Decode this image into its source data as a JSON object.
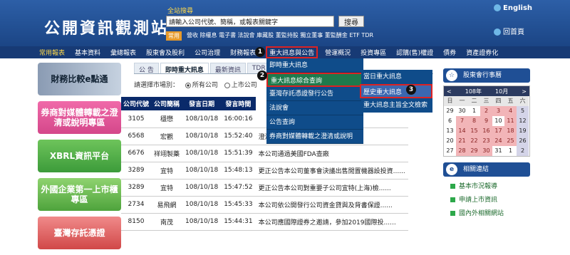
{
  "header": {
    "logo": "公開資訊觀測站",
    "search_title": "全站搜尋",
    "search_placeholder": "請輸入公司代號、簡稱，或報表關鍵字",
    "search_button": "搜尋",
    "common_badge": "常用",
    "common_links": "營收 除權息 電子書 法說會 庫藏股 董監持股 獨立董事 董監酬金 ETF TDR",
    "english": "English",
    "home": "回首頁"
  },
  "nav": {
    "items": [
      "常用報表",
      "基本資料",
      "彙總報表",
      "股東會及股利",
      "公司治理",
      "財務報表",
      "重大訊息與公告",
      "營運概況",
      "投資專區",
      "認購(售)權證",
      "債券",
      "資產證券化"
    ]
  },
  "left_banners": [
    "財務比較e點通",
    "券商對媒體轉載之澄清或說明專區",
    "XBRL資訊平台",
    "外國企業第一上市櫃專區",
    "臺灣存託憑證"
  ],
  "sub_tabs": [
    "公  告",
    "即時重大訊息",
    "最新資訊",
    "TDR"
  ],
  "market": {
    "label": "請選擇市場別：",
    "options": [
      "所有公司",
      "上市公司"
    ]
  },
  "menu1": [
    "即時重大訊息",
    "重大訊息綜合查詢",
    "臺灣存託憑證發行公告",
    "法說會",
    "公告查詢",
    "券商對媒體轉載之澄清或說明"
  ],
  "menu2": [
    "當日重大訊息",
    "歷史重大訊息",
    "重大訊息主旨全文檢索"
  ],
  "badges": [
    "1",
    "2",
    "3"
  ],
  "table": {
    "headers": [
      "公司代號",
      "公司簡稱",
      "發言日期",
      "發言時間"
    ],
    "rows": [
      [
        "3105",
        "穩懋",
        "108/10/18",
        "16:00:16",
        ""
      ],
      [
        "6568",
        "宏觀",
        "108/10/18",
        "15:52:40",
        "澄清媒體報導"
      ],
      [
        "6676",
        "祥翊製藥",
        "108/10/18",
        "15:51:39",
        "本公司通過美國FDA查廠"
      ],
      [
        "3289",
        "宜特",
        "108/10/18",
        "15:48:13",
        "更正公告本公司董事會決議出售閒置機器設投資......"
      ],
      [
        "3289",
        "宜特",
        "108/10/18",
        "15:47:52",
        "更正公告本公司對重要子公司宜特(上海)檢......"
      ],
      [
        "2734",
        "易飛網",
        "108/10/18",
        "15:45:33",
        "本公司依公開發行公司資金貸與及背書保證......"
      ],
      [
        "8150",
        "南茂",
        "108/10/18",
        "15:44:31",
        "本公司應國際證券之邀請，參加2019國際投......"
      ]
    ]
  },
  "right": {
    "calendar_title": "股東會行事曆",
    "year": "108年",
    "month": "10月",
    "weekdays": [
      "日",
      "一",
      "二",
      "三",
      "四",
      "五",
      "六"
    ],
    "weeks": [
      [
        "29",
        "30",
        "1",
        "2",
        "3",
        "4",
        "5"
      ],
      [
        "6",
        "7",
        "8",
        "9",
        "10",
        "11",
        "12"
      ],
      [
        "13",
        "14",
        "15",
        "16",
        "17",
        "18",
        "19"
      ],
      [
        "20",
        "21",
        "22",
        "23",
        "24",
        "25",
        "26"
      ],
      [
        "27",
        "28",
        "29",
        "30",
        "31",
        "1",
        "2"
      ]
    ],
    "related_title": "相關連結",
    "related_links": [
      "基本市況報導",
      "申請上市資訊",
      "國內外相關網站"
    ]
  }
}
